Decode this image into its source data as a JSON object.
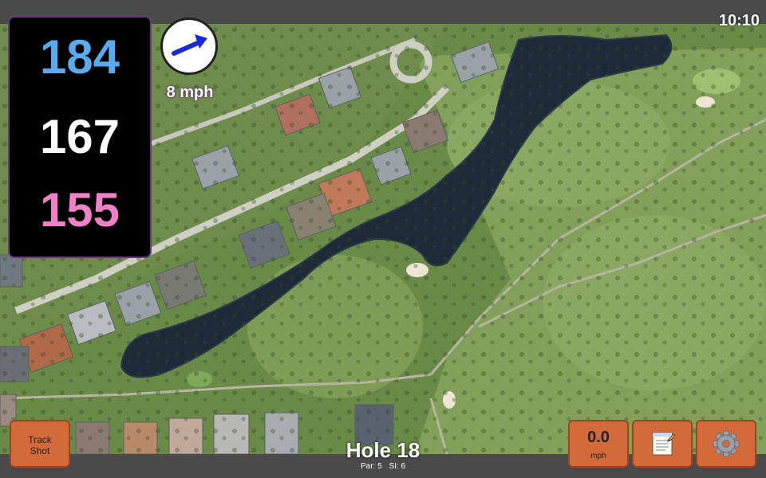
{
  "status_bar": {
    "time": "10:10"
  },
  "yardages": {
    "back": "184",
    "middle": "167",
    "front": "155"
  },
  "wind": {
    "speed_label": "8 mph",
    "direction": "east-northeast",
    "readout_value": "0.0",
    "readout_unit": "mph"
  },
  "hole": {
    "title": "Hole 18",
    "par_label": "Par: 5",
    "si_label": "SI: 6"
  },
  "buttons": {
    "track_shot_line1": "Track",
    "track_shot_line2": "Shot"
  },
  "icons": {
    "notes": "notepad-icon",
    "settings": "gear-icon",
    "wind": "wind-arrow-icon"
  },
  "colors": {
    "back_yardage": "#5aaaf0",
    "middle_yardage": "#ffffff",
    "front_yardage": "#f080c8",
    "button": "#d46a3a",
    "wind_arrow": "#1a2ad8"
  }
}
